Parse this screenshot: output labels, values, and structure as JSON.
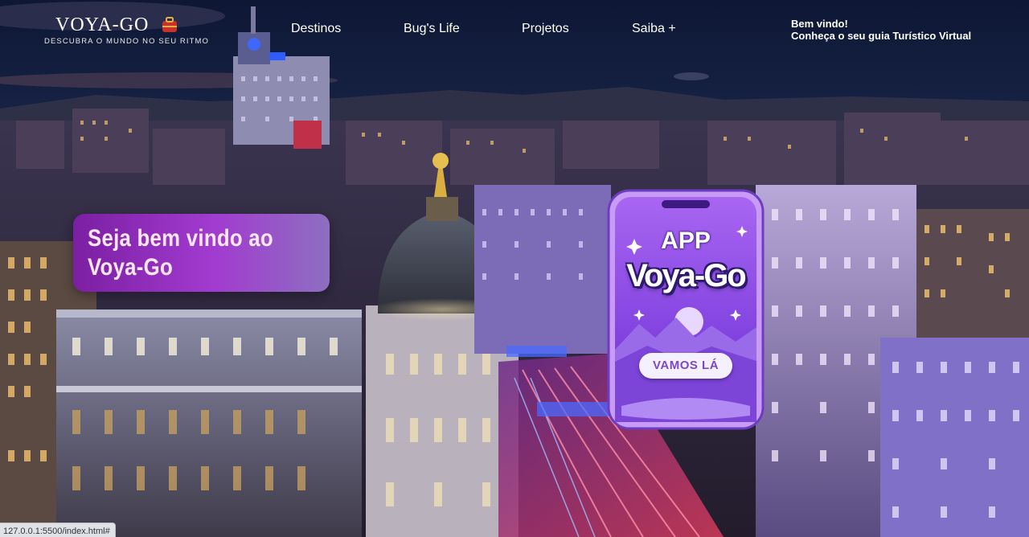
{
  "header": {
    "logo": {
      "title": "VOYA-GO",
      "tagline": "DESCUBRA O MUNDO NO SEU RITMO",
      "badge_icon": "suitcase-icon"
    },
    "nav": [
      {
        "label": "Destinos"
      },
      {
        "label": "Bug's Life"
      },
      {
        "label": "Projetos"
      },
      {
        "label": "Saiba +"
      }
    ],
    "welcome": {
      "line1": "Bem vindo!",
      "line2": "Conheça o seu guia Turístico Virtual"
    }
  },
  "hero": {
    "line1": "Seja bem vindo ao",
    "line2": "Voya-Go"
  },
  "app_card": {
    "label": "APP",
    "brand": "Voya-Go",
    "button_label": "VAMOS LÁ",
    "colors": {
      "frame": "#b26cf0",
      "screen_top": "#9b5cf0",
      "screen_bottom": "#6a2fd6"
    }
  },
  "status_bar": {
    "url": "127.0.0.1:5500/index.html#"
  },
  "colors": {
    "hero_banner_start": "#7b1fa2",
    "hero_banner_end": "#8d6fc0",
    "hero_text": "#ffe6f0",
    "sky_top": "#101a3a",
    "sky_bottom": "#2a3a6e"
  }
}
